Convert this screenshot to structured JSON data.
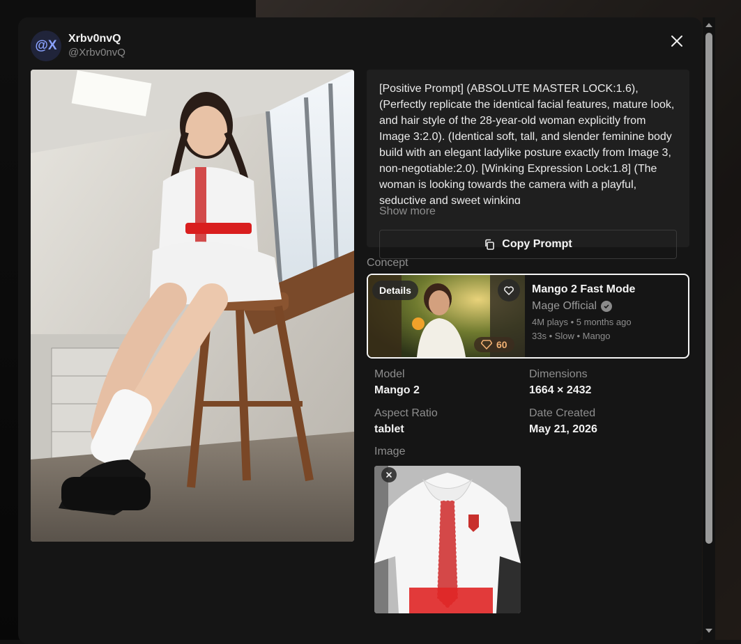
{
  "user": {
    "avatar_text": "@X",
    "name": "Xrbv0nvQ",
    "handle": "@Xrbv0nvQ"
  },
  "prompt": {
    "text": "[Positive Prompt] (ABSOLUTE MASTER LOCK:1.6), (Perfectly replicate the identical facial features, mature look, and hair style of the 28-year-old woman explicitly from Image 3:2.0). (Identical soft, tall, and slender feminine body build with an elegant ladylike posture exactly from Image 3, non-negotiable:2.0). [Winking Expression Lock:1.8] (The woman is looking towards the camera with a playful, seductive and sweet winking",
    "show_more": "Show more",
    "copy_label": "Copy Prompt"
  },
  "concept": {
    "section_label": "Concept",
    "details_label": "Details",
    "gem_count": "60",
    "title": "Mango 2 Fast Mode",
    "author": "Mage Official",
    "meta_line1": "4M plays • 5 months ago",
    "meta_line2": "33s • Slow • Mango"
  },
  "meta": {
    "model_label": "Model",
    "model_value": "Mango 2",
    "dimensions_label": "Dimensions",
    "dimensions_value": "1664 × 2432",
    "aspect_label": "Aspect Ratio",
    "aspect_value": "tablet",
    "date_label": "Date Created",
    "date_value": "May 21, 2026"
  },
  "image_section_label": "Image",
  "colors": {
    "modal_bg": "#151515",
    "panel_bg": "#1f1f1f",
    "gem_color": "#f1b173"
  }
}
